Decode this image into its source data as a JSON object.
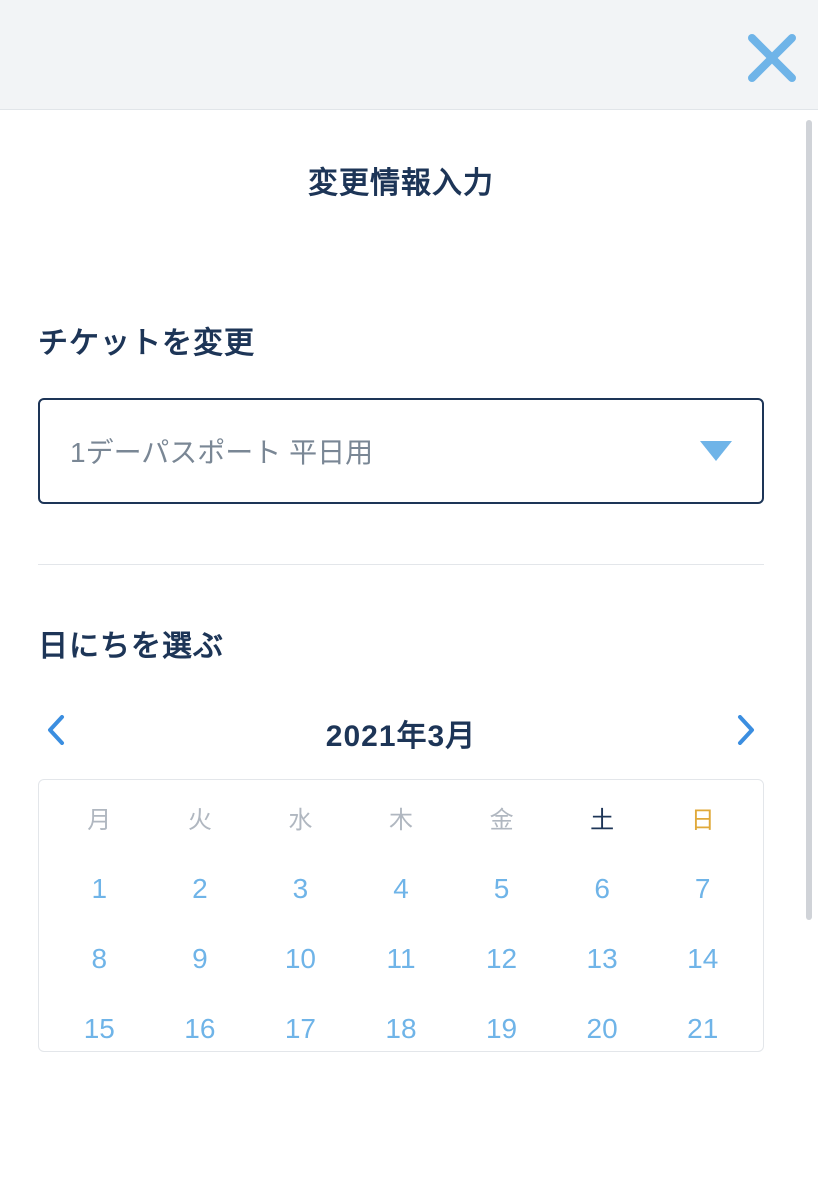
{
  "header": {
    "page_title": "変更情報入力"
  },
  "ticket_section": {
    "title": "チケットを変更",
    "selected": "1デーパスポート 平日用"
  },
  "date_section": {
    "title": "日にちを選ぶ",
    "month_label": "2021年3月",
    "dow": [
      "月",
      "火",
      "水",
      "木",
      "金",
      "土",
      "日"
    ],
    "days_row1": [
      "1",
      "2",
      "3",
      "4",
      "5",
      "6",
      "7"
    ],
    "days_row2": [
      "8",
      "9",
      "10",
      "11",
      "12",
      "13",
      "14"
    ],
    "days_row3": [
      "15",
      "16",
      "17",
      "18",
      "19",
      "20",
      "21"
    ]
  }
}
